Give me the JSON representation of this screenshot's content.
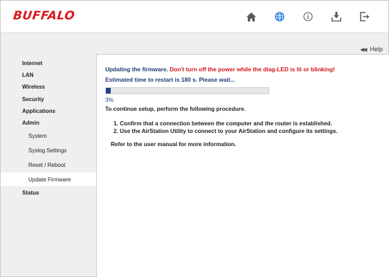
{
  "header": {
    "logo": "BUFFALO",
    "icons": [
      "home-icon",
      "globe-icon",
      "info-icon",
      "download-icon",
      "logout-icon"
    ],
    "accent_color": "#1a7ad9",
    "icon_color": "#555555"
  },
  "help": {
    "label": "Help"
  },
  "sidebar": {
    "items": [
      {
        "label": "Internet"
      },
      {
        "label": "LAN"
      },
      {
        "label": "Wireless"
      },
      {
        "label": "Security"
      },
      {
        "label": "Applications"
      },
      {
        "label": "Admin"
      },
      {
        "label": "System"
      },
      {
        "label": "Syslog Settings"
      },
      {
        "label": "Reset / Reboot"
      },
      {
        "label": "Update Firmware",
        "active": true
      },
      {
        "label": "Status"
      }
    ]
  },
  "main": {
    "status_prefix": "Updating the firmware.",
    "warning": "Don't turn off the power while the diag-LED is lit or blinking!",
    "estimate": "Estimated time to restart is 180 s. Please wait...",
    "progress_percent": 3,
    "progress_label": "3%",
    "instruction": "To continue setup, perform the following procedure.",
    "steps": [
      "1.  Confirm that a connection between the computer and the router is established.",
      "2.  Use the AirStation Utility to connect to your AirStation and configure its settings."
    ],
    "refer": "Refer to the user manual for more information."
  }
}
